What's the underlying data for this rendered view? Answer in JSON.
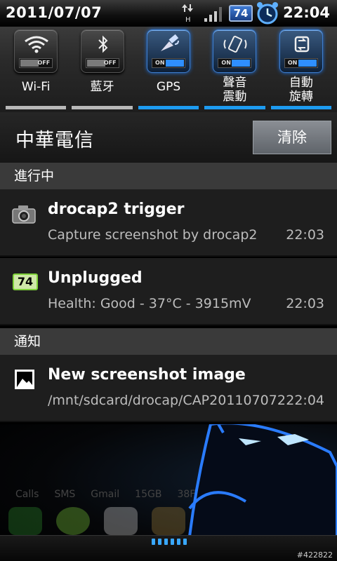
{
  "status_bar": {
    "date": "2011/07/07",
    "time": "22:04",
    "battery_level": "74",
    "data_indicator": "H",
    "icons": [
      "data-arrows-icon",
      "signal-icon",
      "battery-icon",
      "alarm-clock-icon"
    ]
  },
  "toggles": [
    {
      "label": "Wi-Fi",
      "state": "OFF",
      "on": false,
      "icon": "wifi-icon"
    },
    {
      "label": "藍牙",
      "state": "OFF",
      "on": false,
      "icon": "bluetooth-icon"
    },
    {
      "label": "GPS",
      "state": "ON",
      "on": true,
      "icon": "gps-satellite-icon"
    },
    {
      "label": "聲音\n震動",
      "state": "ON",
      "on": true,
      "icon": "vibrate-icon"
    },
    {
      "label": "自動\n旋轉",
      "state": "ON",
      "on": true,
      "icon": "auto-rotate-icon"
    }
  ],
  "carrier": {
    "name": "中華電信",
    "clear_label": "清除"
  },
  "ongoing": {
    "header": "進行中",
    "items": [
      {
        "title": "drocap2 trigger",
        "text": "Capture screenshot by drocap2",
        "time": "22:03",
        "icon": "camera-icon"
      },
      {
        "title": "Unplugged",
        "text": "Health: Good - 37°C - 3915mV",
        "time": "22:03",
        "icon": "battery-icon",
        "badge": "74"
      }
    ]
  },
  "notifications": {
    "header": "通知",
    "items": [
      {
        "title": "New screenshot image",
        "text": "/mnt/sdcard/drocap/CAP201107072",
        "time": "22:04",
        "icon": "image-icon"
      }
    ]
  },
  "home": {
    "labels": [
      "Calls",
      "SMS",
      "Gmail",
      "15GB",
      "38F"
    ],
    "watermark": "#422822"
  },
  "colors": {
    "accent": "#1d9bf0",
    "off_bar": "#b8b8b8",
    "section_header": "#3a3a3a"
  }
}
